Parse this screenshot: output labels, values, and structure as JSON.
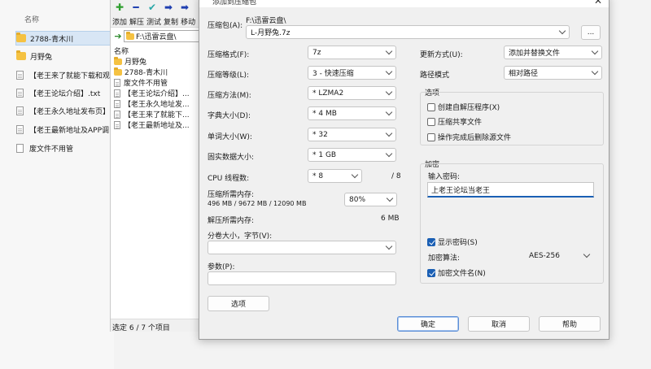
{
  "explorer": {
    "column_name": "名称",
    "items": [
      {
        "label": "2788-青木川",
        "type": "folder",
        "selected": true
      },
      {
        "label": "月野兔",
        "type": "folder",
        "selected": false
      },
      {
        "label": "【老王来了就能下载和观",
        "type": "file",
        "selected": false
      },
      {
        "label": "【老王论坛介绍】.txt",
        "type": "file",
        "selected": false
      },
      {
        "label": "【老王永久地址发布页】",
        "type": "file",
        "selected": false
      },
      {
        "label": "【老王最新地址及APP调",
        "type": "file",
        "selected": false
      },
      {
        "label": "废文件不用管",
        "type": "blank",
        "selected": false
      }
    ]
  },
  "file_manager": {
    "toolbar_labels": [
      "添加",
      "解压",
      "测试",
      "复制",
      "移动"
    ],
    "toolbar_icon_colors": [
      "#2e9e2e",
      "#1f3fb0",
      "#2aa7a7",
      "#1f3fb0",
      "#1f3fb0"
    ],
    "address": "F:\\迅雷云盘\\",
    "column_name": "名称",
    "items": [
      {
        "label": "月野兔",
        "type": "folder"
      },
      {
        "label": "2788-青木川",
        "type": "folder"
      },
      {
        "label": "废文件不用管",
        "type": "file"
      },
      {
        "label": "【老王论坛介绍】...",
        "type": "file"
      },
      {
        "label": "【老王永久地址发...",
        "type": "file"
      },
      {
        "label": "【老王来了就能下...",
        "type": "file"
      },
      {
        "label": "【老王最新地址及...",
        "type": "file"
      }
    ],
    "status": "选定 6 / 7 个项目"
  },
  "dialog": {
    "title": "添加到压缩包",
    "archive_label": "压缩包(A):",
    "archive_path": "F:\\迅雷云盘\\",
    "archive_name": "L-月野兔.7z",
    "browse_label": "...",
    "format_label": "压缩格式(F):",
    "format_value": "7z",
    "level_label": "压缩等级(L):",
    "level_value": "3 - 快速压缩",
    "method_label": "压缩方法(M):",
    "method_value": "* LZMA2",
    "dict_label": "字典大小(D):",
    "dict_value": "* 4 MB",
    "word_label": "单词大小(W):",
    "word_value": "* 32",
    "solid_label": "固实数据大小:",
    "solid_value": "* 1 GB",
    "threads_label": "CPU 线程数:",
    "threads_value": "* 8",
    "threads_max": "/ 8",
    "mem_comp_label": "压缩所需内存:",
    "mem_comp_detail": "496 MB / 9672 MB / 12090 MB",
    "mem_percent": "80%",
    "mem_decomp_label": "解压所需内存:",
    "mem_decomp_value": "6 MB",
    "split_label": "分卷大小，字节(V):",
    "split_value": "",
    "params_label": "参数(P):",
    "params_value": "",
    "options_button": "选项",
    "update_label": "更新方式(U):",
    "update_value": "添加并替换文件",
    "path_label": "路径模式",
    "path_value": "相对路径",
    "options_group": "选项",
    "opt_sfx": "创建自解压程序(X)",
    "opt_shared": "压缩共享文件",
    "opt_delete": "操作完成后删除源文件",
    "encrypt_group": "加密",
    "password_label": "输入密码:",
    "password_value": "上老王论坛当老王",
    "show_password": "显示密码(S)",
    "enc_method_label": "加密算法:",
    "enc_method_value": "AES-256",
    "encrypt_names": "加密文件名(N)",
    "ok": "确定",
    "cancel": "取消",
    "help": "帮助"
  }
}
